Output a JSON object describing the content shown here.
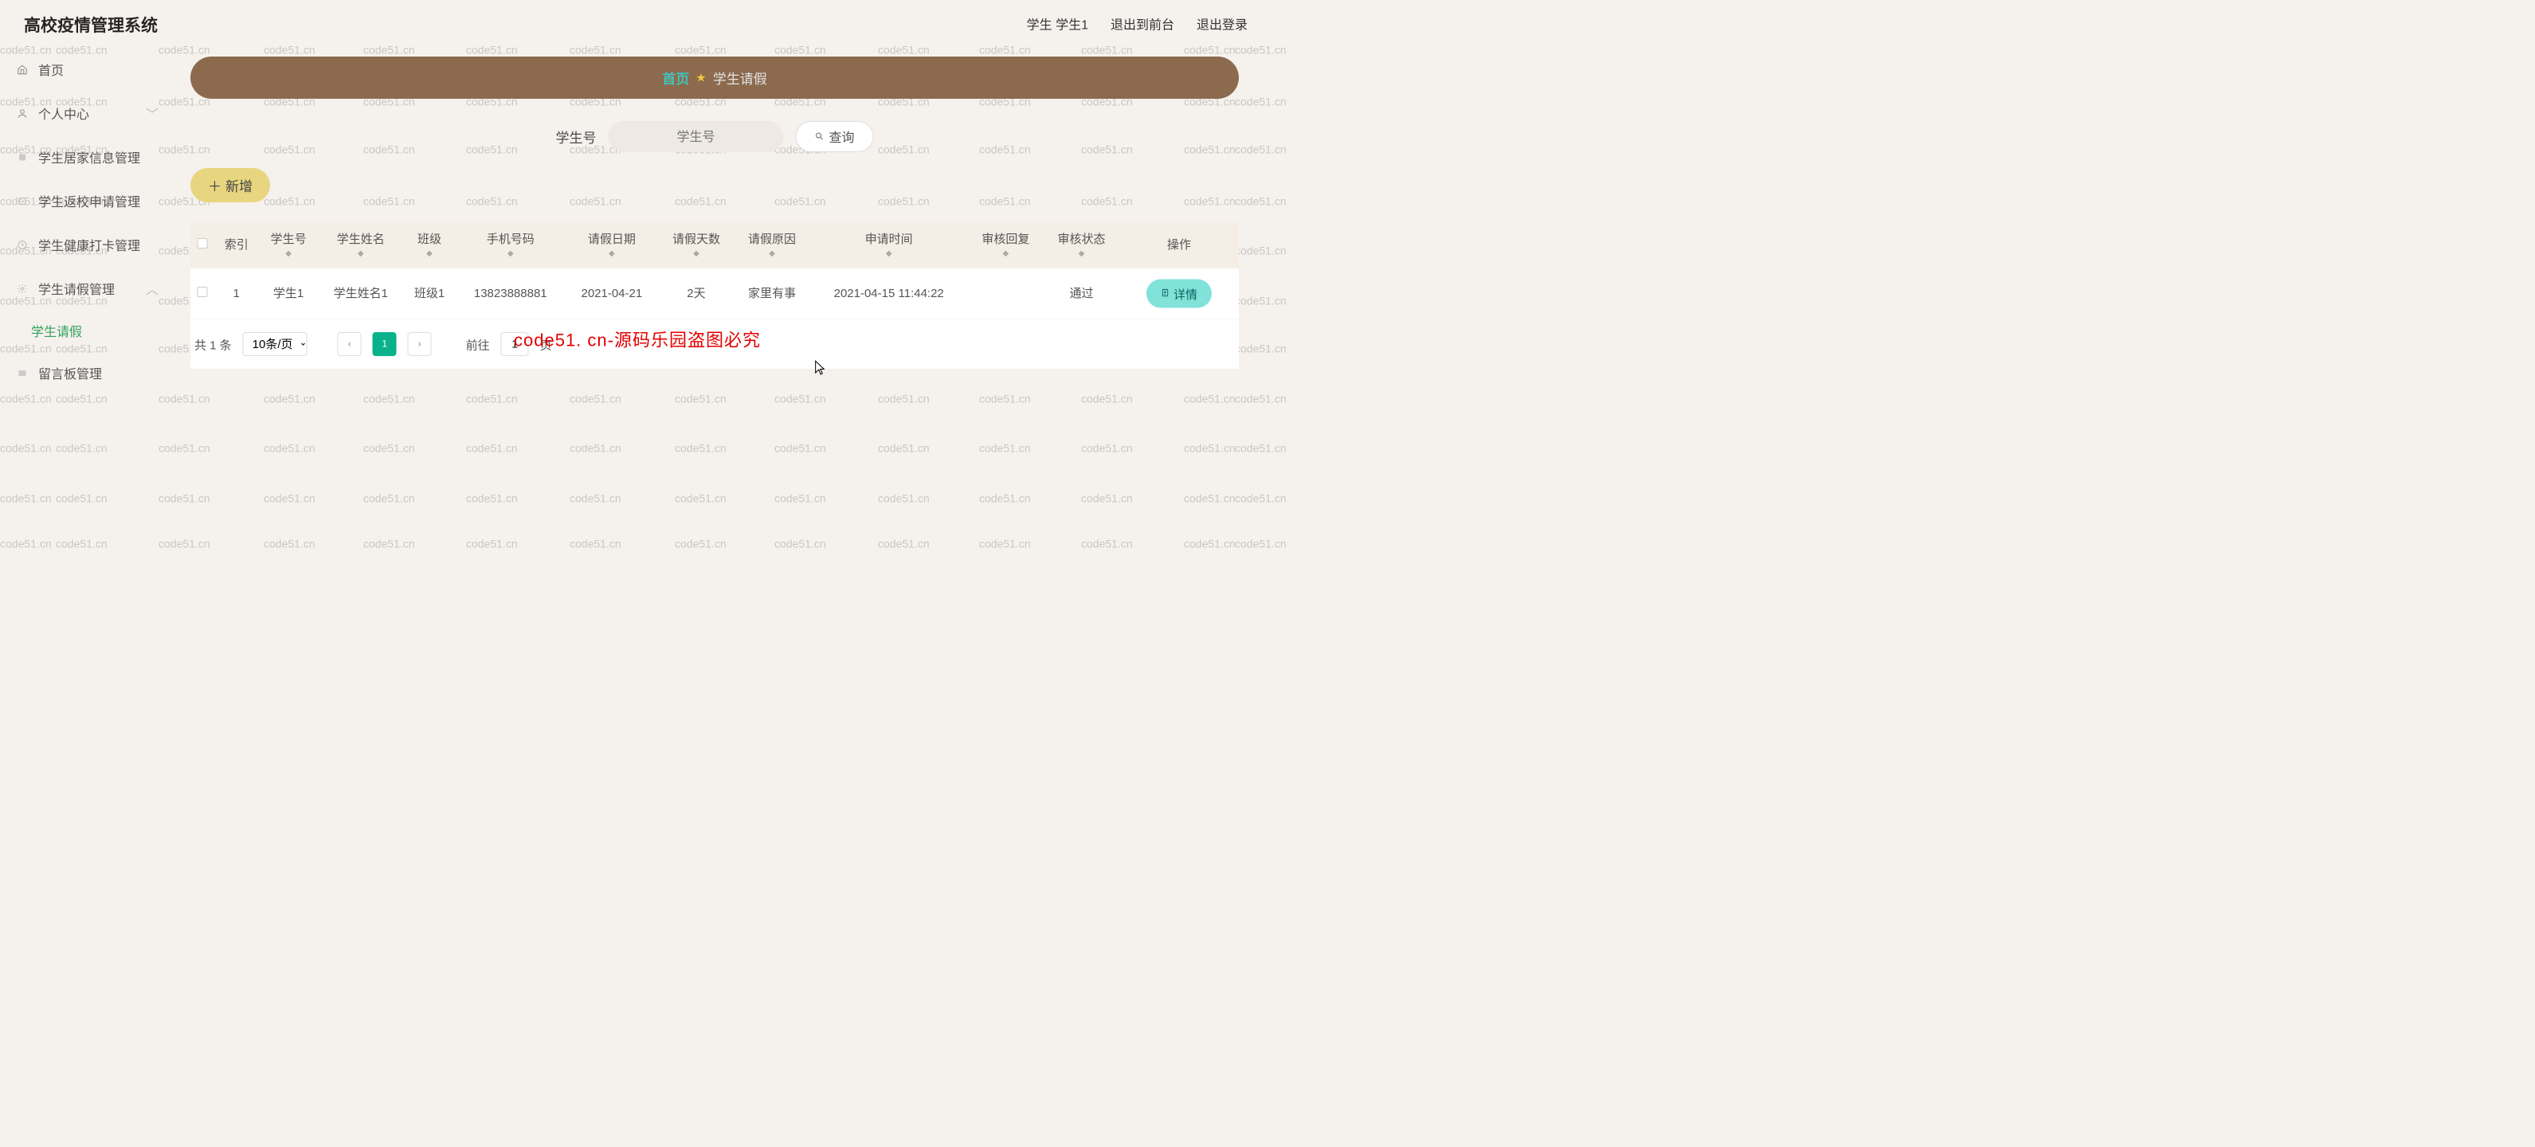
{
  "topbar": {
    "title": "高校疫情管理系统",
    "user_label": "学生 学生1",
    "back_to_front": "退出到前台",
    "logout": "退出登录"
  },
  "sidebar": {
    "home": "首页",
    "personal": "个人中心",
    "student_home_info": "学生居家信息管理",
    "return_apply": "学生返校申请管理",
    "health_checkin": "学生健康打卡管理",
    "leave_mgmt": "学生请假管理",
    "leave_sub": "学生请假",
    "message_board": "留言板管理"
  },
  "breadcrumb": {
    "home": "首页",
    "current": "学生请假"
  },
  "search": {
    "label": "学生号",
    "placeholder": "学生号",
    "button": "查询"
  },
  "buttons": {
    "add": "新增",
    "detail": "详情"
  },
  "table": {
    "headers": {
      "index": "索引",
      "student_no": "学生号",
      "student_name": "学生姓名",
      "class": "班级",
      "phone": "手机号码",
      "leave_date": "请假日期",
      "leave_days": "请假天数",
      "leave_reason": "请假原因",
      "apply_time": "申请时间",
      "review_reply": "审核回复",
      "review_status": "审核状态",
      "action": "操作"
    },
    "rows": [
      {
        "index": "1",
        "student_no": "学生1",
        "student_name": "学生姓名1",
        "class": "班级1",
        "phone": "13823888881",
        "leave_date": "2021-04-21",
        "leave_days": "2天",
        "leave_reason": "家里有事",
        "apply_time": "2021-04-15 11:44:22",
        "review_reply": "",
        "review_status": "通过"
      }
    ]
  },
  "pagination": {
    "total": "共 1 条",
    "page_size": "10条/页",
    "current_page": "1",
    "goto_label": "前往",
    "page_suffix": "页",
    "goto_value": "1"
  },
  "overlay": {
    "watermark_text": "code51.cn",
    "banner": "code51. cn-源码乐园盗图必究"
  }
}
